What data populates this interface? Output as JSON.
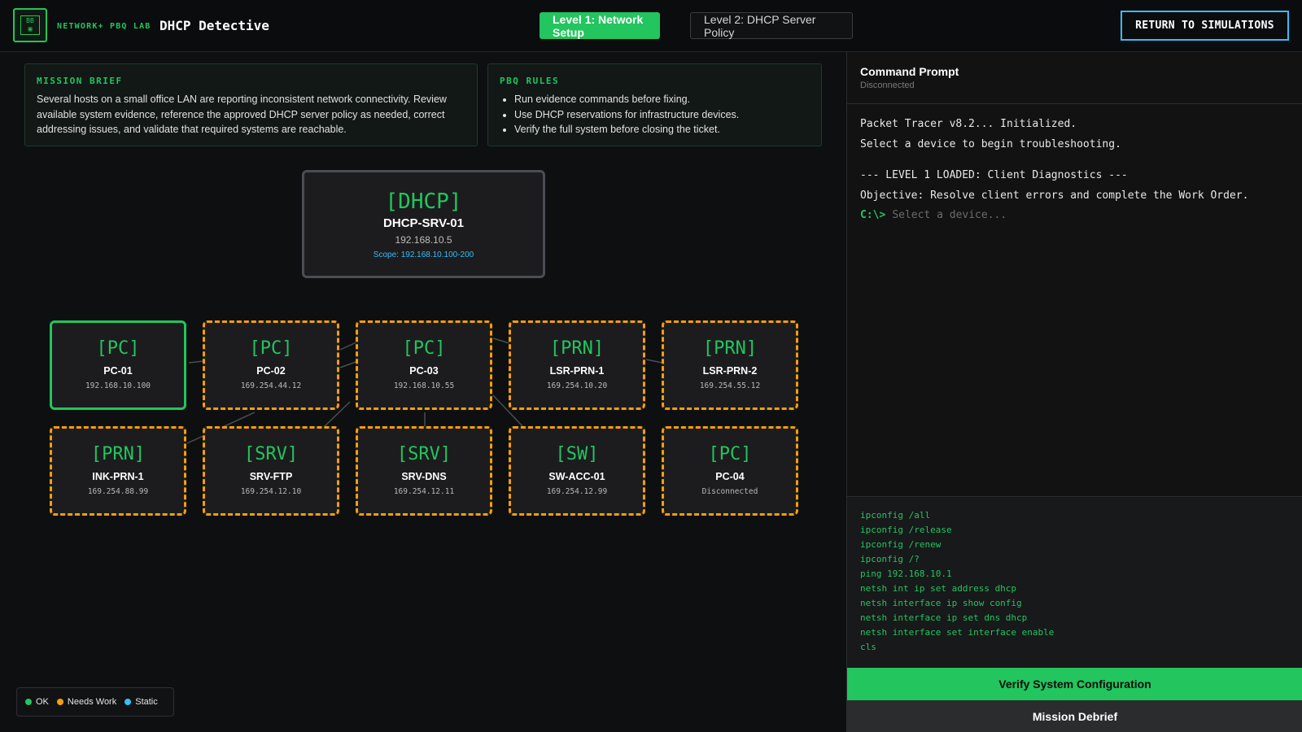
{
  "header": {
    "logo_text": "BB",
    "brand_sub": "NETWORK+ PBQ LAB",
    "brand_title": "DHCP Detective",
    "level_tabs": [
      {
        "label": "Level 1: Network Setup",
        "active": true
      },
      {
        "label": "Level 2: DHCP Server Policy",
        "active": false
      }
    ],
    "return_label": "RETURN TO SIMULATIONS"
  },
  "mission": {
    "title": "MISSION BRIEF",
    "text": "Several hosts on a small office LAN are reporting inconsistent network connectivity. Review available system evidence, reference the approved DHCP server policy as needed, correct addressing issues, and validate that required systems are reachable."
  },
  "rules": {
    "title": "PBQ RULES",
    "items": [
      "Run evidence commands before fixing.",
      "Use DHCP reservations for infrastructure devices.",
      "Verify the full system before closing the ticket."
    ]
  },
  "dhcp_server": {
    "tag": "[DHCP]",
    "name": "DHCP-SRV-01",
    "ip": "192.168.10.5",
    "scope": "Scope: 192.168.10.100-200"
  },
  "devices": [
    {
      "tag": "[PC]",
      "name": "PC-01",
      "ip": "192.168.10.100",
      "status": "ok"
    },
    {
      "tag": "[PC]",
      "name": "PC-02",
      "ip": "169.254.44.12",
      "status": "needs-work"
    },
    {
      "tag": "[PC]",
      "name": "PC-03",
      "ip": "192.168.10.55",
      "status": "needs-work"
    },
    {
      "tag": "[PRN]",
      "name": "LSR-PRN-1",
      "ip": "169.254.10.20",
      "status": "needs-work"
    },
    {
      "tag": "[PRN]",
      "name": "LSR-PRN-2",
      "ip": "169.254.55.12",
      "status": "needs-work"
    },
    {
      "tag": "[PRN]",
      "name": "INK-PRN-1",
      "ip": "169.254.88.99",
      "status": "needs-work"
    },
    {
      "tag": "[SRV]",
      "name": "SRV-FTP",
      "ip": "169.254.12.10",
      "status": "needs-work"
    },
    {
      "tag": "[SRV]",
      "name": "SRV-DNS",
      "ip": "169.254.12.11",
      "status": "needs-work"
    },
    {
      "tag": "[SW]",
      "name": "SW-ACC-01",
      "ip": "169.254.12.99",
      "status": "needs-work"
    },
    {
      "tag": "[PC]",
      "name": "PC-04",
      "ip": "Disconnected",
      "status": "needs-work"
    }
  ],
  "legend": {
    "items": [
      {
        "label": "OK",
        "color": "#22c55e"
      },
      {
        "label": "Needs Work",
        "color": "#f59e0b"
      },
      {
        "label": "Static",
        "color": "#38bdf8"
      }
    ]
  },
  "terminal": {
    "title": "Command Prompt",
    "status": "Disconnected",
    "lines": [
      "Packet Tracer v8.2... Initialized.",
      "Select a device to begin troubleshooting.",
      "",
      "--- LEVEL 1 LOADED: Client Diagnostics ---",
      "Objective: Resolve client errors and complete the Work Order."
    ],
    "prompt": "C:\\>",
    "input_placeholder": "Select a device..."
  },
  "commands": [
    "ipconfig /all",
    "ipconfig /release",
    "ipconfig /renew",
    "ipconfig /?",
    "ping 192.168.10.1",
    "netsh int ip set address dhcp",
    "netsh interface ip show config",
    "netsh interface ip set dns dhcp",
    "netsh interface set interface enable",
    "cls"
  ],
  "actions": {
    "verify_label": "Verify System Configuration",
    "debrief_label": "Mission Debrief"
  },
  "colors": {
    "accent_green": "#22c55e",
    "warning_orange": "#f59e0b",
    "static_blue": "#38bdf8"
  }
}
